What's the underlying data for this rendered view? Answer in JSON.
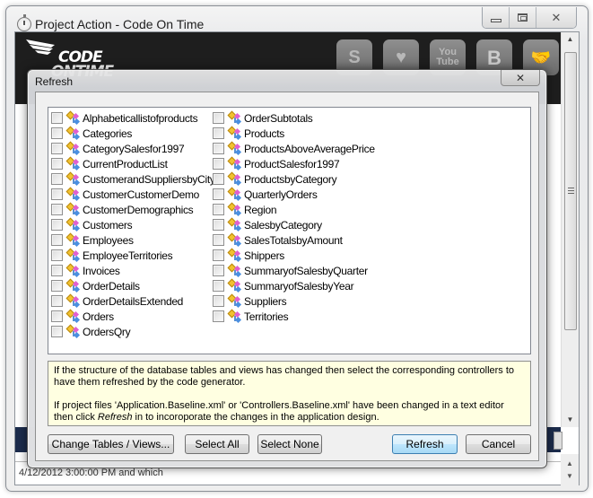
{
  "window": {
    "title": "Project Action - Code On Time",
    "app_icon": "stopwatch-icon",
    "caption_buttons": {
      "minimize": "minimize-icon",
      "maximize": "maximize-icon",
      "close": "✕"
    }
  },
  "banner": {
    "logo_line1": "CODE",
    "logo_line2": "ONTIME",
    "social_icons": [
      {
        "name": "getsatisfaction-icon",
        "label": "S"
      },
      {
        "name": "community-icon",
        "label": "♥"
      },
      {
        "name": "youtube-icon",
        "label": "You\nTube"
      },
      {
        "name": "blogger-icon",
        "label": "B"
      },
      {
        "name": "partners-icon",
        "label": "🤝"
      }
    ]
  },
  "status": {
    "text": "4/12/2012 3:00:00 PM and which"
  },
  "dialog": {
    "title": "Refresh",
    "close_label": "✕",
    "controllers_col1": [
      "Alphabeticallistofproducts",
      "Categories",
      "CategorySalesfor1997",
      "CurrentProductList",
      "CustomerandSuppliersbyCity",
      "CustomerCustomerDemo",
      "CustomerDemographics",
      "Customers",
      "Employees",
      "EmployeeTerritories",
      "Invoices",
      "OrderDetails",
      "OrderDetailsExtended",
      "Orders",
      "OrdersQry"
    ],
    "controllers_col2": [
      "OrderSubtotals",
      "Products",
      "ProductsAboveAveragePrice",
      "ProductSalesfor1997",
      "ProductsbyCategory",
      "QuarterlyOrders",
      "Region",
      "SalesbyCategory",
      "SalesTotalsbyAmount",
      "Shippers",
      "SummaryofSalesbyQuarter",
      "SummaryofSalesbyYear",
      "Suppliers",
      "Territories"
    ],
    "info": {
      "paragraph1": "If the structure of the database tables and views has changed then select the corresponding controllers to have them refreshed by the code generator.",
      "paragraph2_prefix": "If project files 'Application.Baseline.xml' or 'Controllers.Baseline.xml' have been changed in a text editor then click ",
      "paragraph2_emphasis": "Refresh",
      "paragraph2_suffix": " in to incoroporate the changes in the application design."
    },
    "buttons": {
      "change_tables": "Change Tables / Views...",
      "select_all": "Select All",
      "select_none": "Select None",
      "refresh": "Refresh",
      "cancel": "Cancel"
    }
  }
}
